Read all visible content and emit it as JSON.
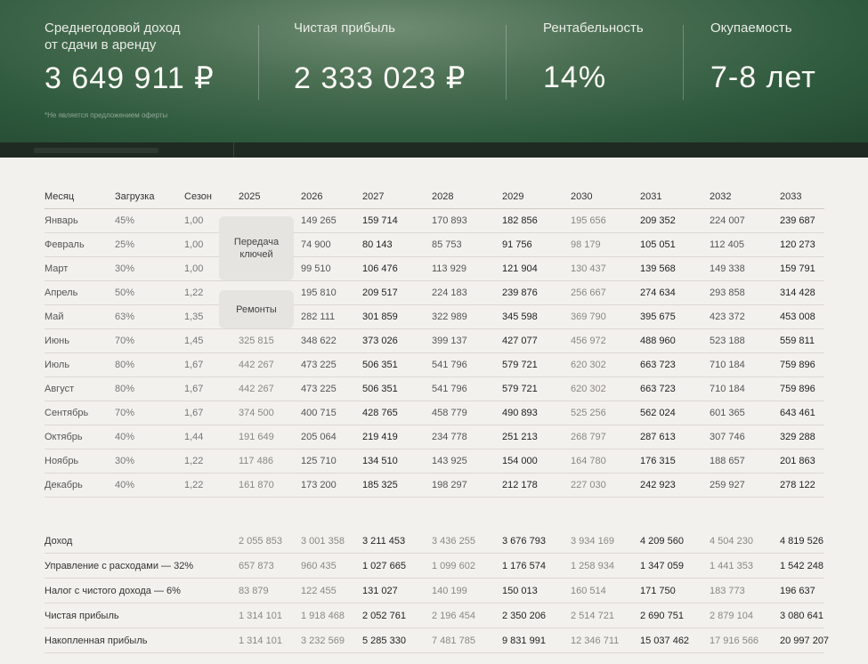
{
  "hero": {
    "stats": [
      {
        "label_line1": "Среднегодовой доход",
        "label_line2": "от сдачи в аренду",
        "value": "3 649 911 ₽"
      },
      {
        "label_line1": "Чистая прибыль",
        "label_line2": "",
        "value": "2 333 023 ₽"
      },
      {
        "label_line1": "Рентабельность",
        "label_line2": "",
        "value": "14%"
      },
      {
        "label_line1": "Окупаемость",
        "label_line2": "",
        "value": "7-8 лет"
      }
    ],
    "disclaimer": "*Не является предложением оферты"
  },
  "table": {
    "headers": [
      "Месяц",
      "Загрузка",
      "Сезон",
      "2025",
      "2026",
      "2027",
      "2028",
      "2029",
      "2030",
      "2031",
      "2032",
      "2033"
    ],
    "pill_keys": "Передача ключей",
    "pill_repairs": "Ремонты",
    "rows": [
      {
        "month": "Январь",
        "load": "45%",
        "season": "1,00",
        "y2025": "",
        "y2026": "149 265",
        "y2027": "159 714",
        "y2028": "170 893",
        "y2029": "182 856",
        "y2030": "195 656",
        "y2031": "209 352",
        "y2032": "224 007",
        "y2033": "239 687"
      },
      {
        "month": "Февраль",
        "load": "25%",
        "season": "1,00",
        "y2025": "",
        "y2026": "74 900",
        "y2027": "80 143",
        "y2028": "85 753",
        "y2029": "91 756",
        "y2030": "98 179",
        "y2031": "105 051",
        "y2032": "112 405",
        "y2033": "120 273"
      },
      {
        "month": "Март",
        "load": "30%",
        "season": "1,00",
        "y2025": "",
        "y2026": "99 510",
        "y2027": "106 476",
        "y2028": "113 929",
        "y2029": "121 904",
        "y2030": "130 437",
        "y2031": "139 568",
        "y2032": "149 338",
        "y2033": "159 791"
      },
      {
        "month": "Апрель",
        "load": "50%",
        "season": "1,22",
        "y2025": "",
        "y2026": "195 810",
        "y2027": "209 517",
        "y2028": "224 183",
        "y2029": "239 876",
        "y2030": "256 667",
        "y2031": "274 634",
        "y2032": "293 858",
        "y2033": "314 428"
      },
      {
        "month": "Май",
        "load": "63%",
        "season": "1,35",
        "y2025": "",
        "y2026": "282 111",
        "y2027": "301 859",
        "y2028": "322 989",
        "y2029": "345 598",
        "y2030": "369 790",
        "y2031": "395 675",
        "y2032": "423 372",
        "y2033": "453 008"
      },
      {
        "month": "Июнь",
        "load": "70%",
        "season": "1,45",
        "y2025": "325 815",
        "y2026": "348 622",
        "y2027": "373 026",
        "y2028": "399 137",
        "y2029": "427 077",
        "y2030": "456 972",
        "y2031": "488 960",
        "y2032": "523 188",
        "y2033": "559 811"
      },
      {
        "month": "Июль",
        "load": "80%",
        "season": "1,67",
        "y2025": "442 267",
        "y2026": "473 225",
        "y2027": "506 351",
        "y2028": "541 796",
        "y2029": "579 721",
        "y2030": "620 302",
        "y2031": "663 723",
        "y2032": "710 184",
        "y2033": "759 896"
      },
      {
        "month": "Август",
        "load": "80%",
        "season": "1,67",
        "y2025": "442 267",
        "y2026": "473 225",
        "y2027": "506 351",
        "y2028": "541 796",
        "y2029": "579 721",
        "y2030": "620 302",
        "y2031": "663 723",
        "y2032": "710 184",
        "y2033": "759 896"
      },
      {
        "month": "Сентябрь",
        "load": "70%",
        "season": "1,67",
        "y2025": "374 500",
        "y2026": "400 715",
        "y2027": "428 765",
        "y2028": "458 779",
        "y2029": "490 893",
        "y2030": "525 256",
        "y2031": "562 024",
        "y2032": "601 365",
        "y2033": "643 461"
      },
      {
        "month": "Октябрь",
        "load": "40%",
        "season": "1,44",
        "y2025": "191 649",
        "y2026": "205 064",
        "y2027": "219 419",
        "y2028": "234 778",
        "y2029": "251 213",
        "y2030": "268 797",
        "y2031": "287 613",
        "y2032": "307 746",
        "y2033": "329 288"
      },
      {
        "month": "Ноябрь",
        "load": "30%",
        "season": "1,22",
        "y2025": "117 486",
        "y2026": "125 710",
        "y2027": "134 510",
        "y2028": "143 925",
        "y2029": "154 000",
        "y2030": "164 780",
        "y2031": "176 315",
        "y2032": "188 657",
        "y2033": "201 863"
      },
      {
        "month": "Декабрь",
        "load": "40%",
        "season": "1,22",
        "y2025": "161 870",
        "y2026": "173 200",
        "y2027": "185 325",
        "y2028": "198 297",
        "y2029": "212 178",
        "y2030": "227 030",
        "y2031": "242 923",
        "y2032": "259 927",
        "y2033": "278 122"
      }
    ],
    "summary": [
      {
        "label": "Доход",
        "y2025": "2 055 853",
        "y2026": "3 001 358",
        "y2027": "3 211 453",
        "y2028": "3 436 255",
        "y2029": "3 676 793",
        "y2030": "3 934 169",
        "y2031": "4 209 560",
        "y2032": "4 504 230",
        "y2033": "4 819 526"
      },
      {
        "label": "Управление с расходами — 32%",
        "y2025": "657 873",
        "y2026": "960 435",
        "y2027": "1 027 665",
        "y2028": "1 099 602",
        "y2029": "1 176 574",
        "y2030": "1 258 934",
        "y2031": "1 347 059",
        "y2032": "1 441 353",
        "y2033": "1 542 248"
      },
      {
        "label": "Налог с чистого дохода — 6%",
        "y2025": "83 879",
        "y2026": "122 455",
        "y2027": "131 027",
        "y2028": "140 199",
        "y2029": "150 013",
        "y2030": "160 514",
        "y2031": "171 750",
        "y2032": "183 773",
        "y2033": "196 637"
      },
      {
        "label": "Чистая прибыль",
        "y2025": "1 314 101",
        "y2026": "1 918 468",
        "y2027": "2 052 761",
        "y2028": "2 196 454",
        "y2029": "2 350 206",
        "y2030": "2 514 721",
        "y2031": "2 690 751",
        "y2032": "2 879 104",
        "y2033": "3 080 641"
      },
      {
        "label": "Накопленная прибыль",
        "y2025": "1 314 101",
        "y2026": "3 232 569",
        "y2027": "5 285 330",
        "y2028": "7 481 785",
        "y2029": "9 831 991",
        "y2030": "12 346 711",
        "y2031": "15 037 462",
        "y2032": "17 916 566",
        "y2033": "20 997 207"
      }
    ]
  }
}
